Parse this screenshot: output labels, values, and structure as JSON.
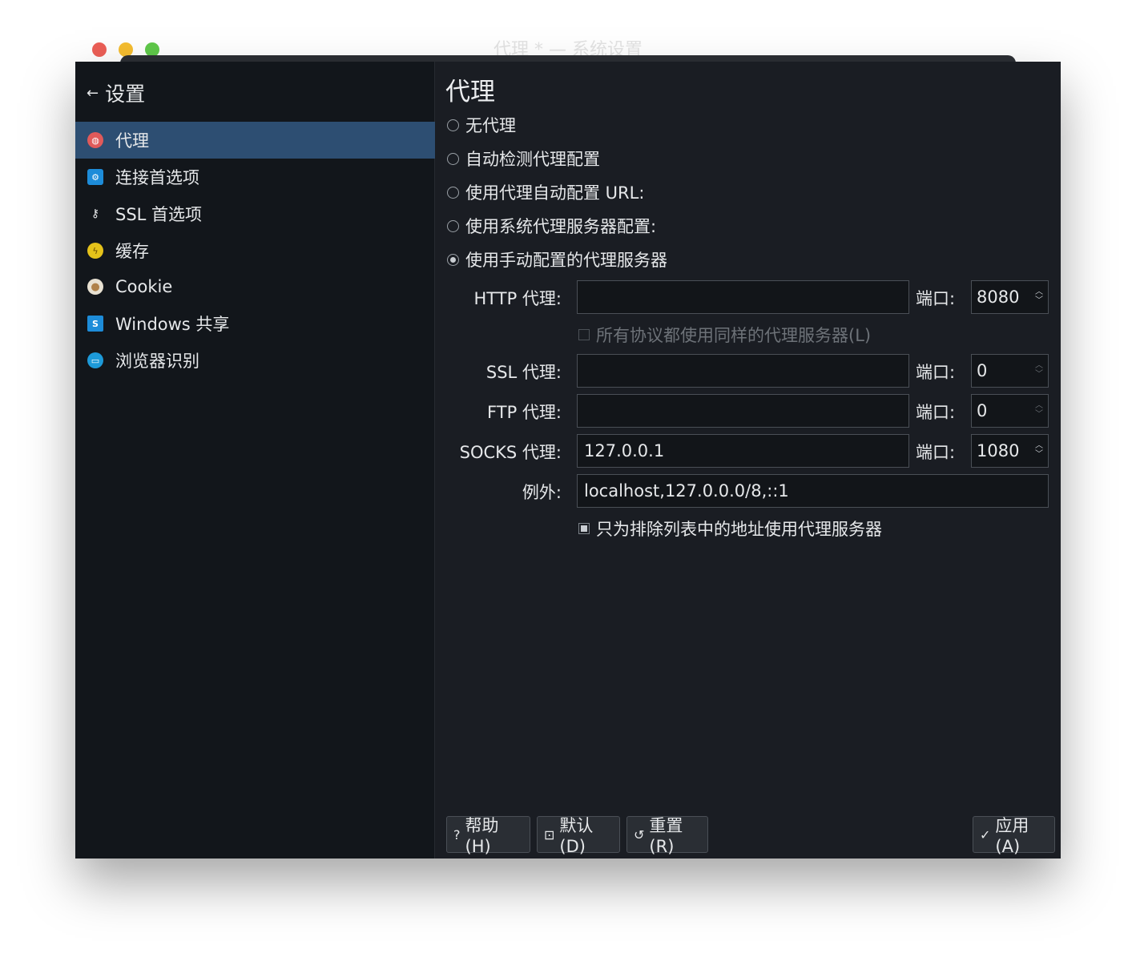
{
  "window": {
    "title": "代理 * — 系统设置"
  },
  "sidebar": {
    "back_label": "设置",
    "items": [
      {
        "label": "代理",
        "icon": "globe-icon",
        "color": "#e05a5a",
        "glyph": "◍"
      },
      {
        "label": "连接首选项",
        "icon": "network-settings-icon",
        "color": "#1d8cd9",
        "glyph": "⚙"
      },
      {
        "label": "SSL 首选项",
        "icon": "ssl-key-icon",
        "color": "#12161b",
        "glyph": "⚷"
      },
      {
        "label": "缓存",
        "icon": "cache-bolt-icon",
        "color": "#e5c21a",
        "glyph": "⚡"
      },
      {
        "label": "Cookie",
        "icon": "cookie-icon",
        "color": "#c79a5a",
        "glyph": "●"
      },
      {
        "label": "Windows 共享",
        "icon": "windows-share-icon",
        "color": "#1d8cd9",
        "glyph": "S"
      },
      {
        "label": "浏览器识别",
        "icon": "browser-id-icon",
        "color": "#1d9ad9",
        "glyph": "▭"
      }
    ]
  },
  "content": {
    "title": "代理",
    "radios": [
      {
        "label": "无代理",
        "checked": false
      },
      {
        "label": "自动检测代理配置",
        "checked": false
      },
      {
        "label": "使用代理自动配置 URL:",
        "checked": false
      },
      {
        "label": "使用系统代理服务器配置:",
        "checked": false
      },
      {
        "label": "使用手动配置的代理服务器",
        "checked": true
      }
    ],
    "port_label": "端口:",
    "http": {
      "label": "HTTP 代理:",
      "value": "",
      "port": "8080"
    },
    "same_proxy": {
      "label": "所有协议都使用同样的代理服务器(L)",
      "checked": false,
      "enabled": false
    },
    "ssl": {
      "label": "SSL 代理:",
      "value": "",
      "port": "0"
    },
    "ftp": {
      "label": "FTP 代理:",
      "value": "",
      "port": "0"
    },
    "socks": {
      "label": "SOCKS 代理:",
      "value": "127.0.0.1",
      "port": "1080"
    },
    "exceptions": {
      "label": "例外:",
      "value": "localhost,127.0.0.0/8,::1"
    },
    "only_exceptions": {
      "label": "只为排除列表中的地址使用代理服务器",
      "checked": true
    }
  },
  "buttons": {
    "help": "帮助(H)",
    "defaults": "默认(D)",
    "reset": "重置(R)",
    "apply": "应用(A)"
  }
}
